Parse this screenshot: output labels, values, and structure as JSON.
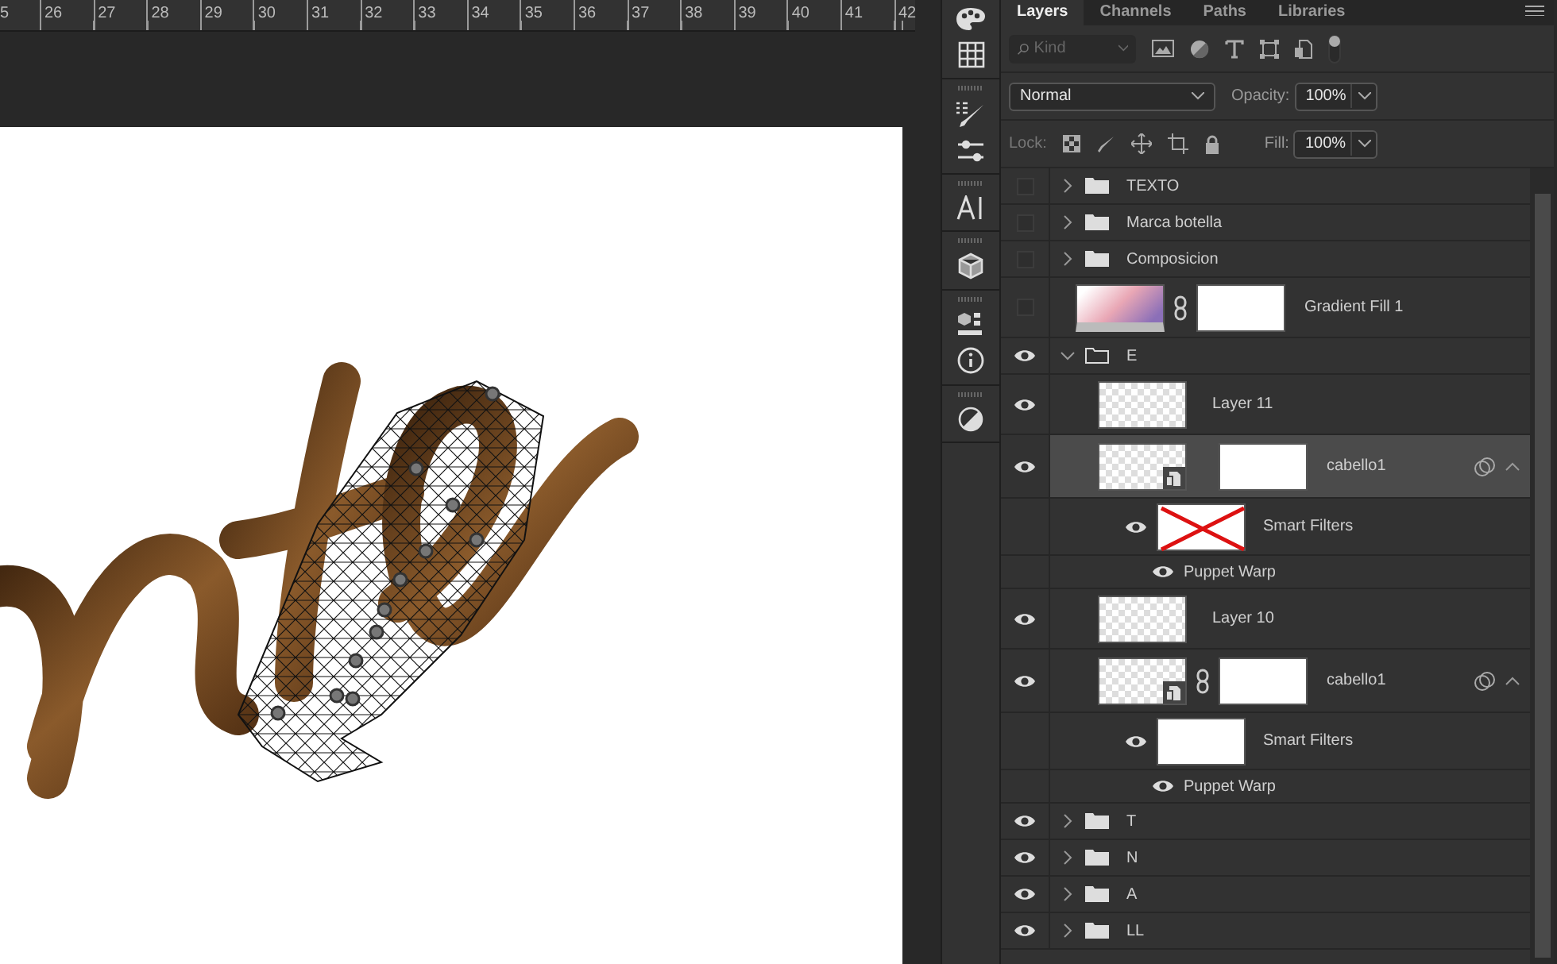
{
  "ruler": {
    "labels": [
      "5",
      "26",
      "27",
      "28",
      "29",
      "30",
      "31",
      "32",
      "33",
      "34",
      "35",
      "36",
      "37",
      "38",
      "39",
      "40",
      "41",
      "42"
    ]
  },
  "tabs": [
    {
      "label": "Layers",
      "selected": true
    },
    {
      "label": "Channels",
      "selected": false
    },
    {
      "label": "Paths",
      "selected": false
    },
    {
      "label": "Libraries",
      "selected": false
    }
  ],
  "filter": {
    "placeholder": "Kind",
    "toggle_on": true
  },
  "blend_mode": "Normal",
  "opacity_label": "Opacity:",
  "opacity": "100%",
  "lock_label": "Lock:",
  "fill_label": "Fill:",
  "fill": "100%",
  "layers": [
    {
      "kind": "group",
      "name": "TEXTO",
      "visible": false,
      "expanded": false,
      "selected": false
    },
    {
      "kind": "group",
      "name": "Marca botella",
      "visible": false,
      "expanded": false,
      "selected": false
    },
    {
      "kind": "group",
      "name": "Composicion",
      "visible": false,
      "expanded": false,
      "selected": false
    },
    {
      "kind": "fill",
      "name": "Gradient Fill 1",
      "visible": false,
      "linked": true,
      "selected": false
    },
    {
      "kind": "group",
      "name": "E",
      "visible": true,
      "expanded": true,
      "selected": false,
      "children": [
        {
          "kind": "pixel",
          "name": "Layer 11",
          "visible": true,
          "selected": false
        },
        {
          "kind": "smart",
          "name": "cabello1",
          "visible": true,
          "linked": false,
          "selected": true,
          "children": [
            {
              "kind": "smart-filters",
              "name": "Smart Filters",
              "visible": true,
              "mask_disabled": true,
              "selected": false
            },
            {
              "kind": "filter",
              "name": "Puppet Warp",
              "visible": true,
              "selected": false
            }
          ]
        },
        {
          "kind": "pixel",
          "name": "Layer 10",
          "visible": true,
          "selected": false
        },
        {
          "kind": "smart",
          "name": "cabello1",
          "visible": true,
          "linked": true,
          "selected": false,
          "children": [
            {
              "kind": "smart-filters",
              "name": "Smart Filters",
              "visible": true,
              "mask_disabled": false,
              "selected": false
            },
            {
              "kind": "filter",
              "name": "Puppet Warp",
              "visible": true,
              "selected": false
            }
          ]
        }
      ]
    },
    {
      "kind": "group",
      "name": "T",
      "visible": true,
      "expanded": false,
      "selected": false
    },
    {
      "kind": "group",
      "name": "N",
      "visible": true,
      "expanded": false,
      "selected": false
    },
    {
      "kind": "group",
      "name": "A",
      "visible": true,
      "expanded": false,
      "selected": false
    },
    {
      "kind": "group",
      "name": "LL",
      "visible": true,
      "expanded": false,
      "selected": false
    }
  ]
}
